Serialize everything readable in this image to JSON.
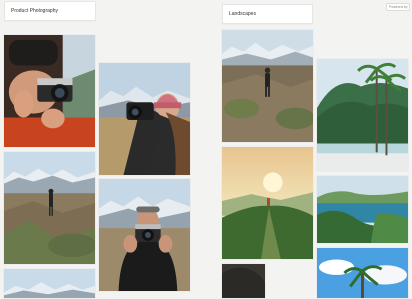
{
  "boards": {
    "left": {
      "title": "Product Photography"
    },
    "right": {
      "title": "Landscapes"
    }
  },
  "top_right_badge": "Powered by",
  "tiles": [
    {
      "name": "tile-portrait-camera-red-jacket",
      "board": "left"
    },
    {
      "name": "tile-woman-pink-beanie",
      "board": "left"
    },
    {
      "name": "tile-hiker-rocky-valley",
      "board": "left"
    },
    {
      "name": "tile-man-camera-black-shirt",
      "board": "left"
    },
    {
      "name": "tile-snowy-peaks-bottom",
      "board": "left"
    },
    {
      "name": "tile-mountain-hiker-ridge",
      "board": "right"
    },
    {
      "name": "tile-tropical-palms-cliffs",
      "board": "right"
    },
    {
      "name": "tile-sunset-green-ridge",
      "board": "right"
    },
    {
      "name": "tile-coast-green-bay",
      "board": "right"
    },
    {
      "name": "tile-rock-bottom",
      "board": "right"
    },
    {
      "name": "tile-palm-sky-bottom",
      "board": "right"
    }
  ]
}
